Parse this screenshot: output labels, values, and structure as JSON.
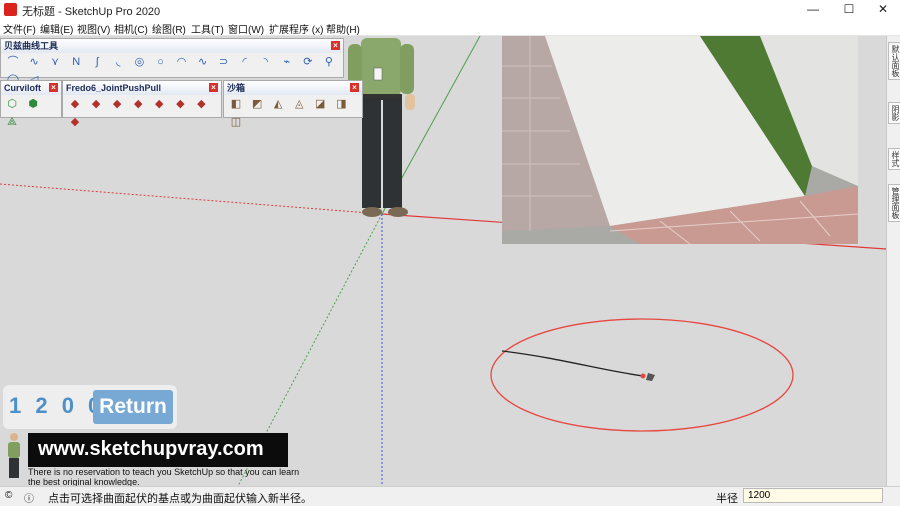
{
  "window": {
    "title": "无标题 - SketchUp Pro 2020",
    "min": "—",
    "max": "☐",
    "close": "✕"
  },
  "menu": [
    "文件(F)",
    "编辑(E)",
    "视图(V)",
    "相机(C)",
    "绘图(R)",
    "工具(T)",
    "窗口(W)",
    "扩展程序 (x)",
    "帮助(H)"
  ],
  "toolbars": {
    "bezier": {
      "title": "贝兹曲线工具",
      "tools": [
        "⌒",
        "∿",
        "⋎",
        "N",
        "∫",
        "◟",
        "◎",
        "○",
        "◠",
        "∿",
        "⊃",
        "◜",
        "◝",
        "⌁",
        "⟳",
        "⚲",
        "◯",
        "◁"
      ]
    },
    "curviloft": {
      "title": "Curviloft",
      "tools": [
        "⬡",
        "⬢",
        "⟁"
      ]
    },
    "fredo": {
      "title": "Fredo6_JointPushPull",
      "tools": [
        "◆",
        "◆",
        "◆",
        "◆",
        "◆",
        "◆",
        "◆",
        "◆"
      ]
    },
    "sandbox": {
      "title": "沙箱",
      "tools": [
        "◧",
        "◩",
        "◭",
        "◬",
        "◪",
        "◨",
        "◫"
      ]
    }
  },
  "rightpanel": {
    "tabs": [
      "默认面板",
      "阴影",
      "样式",
      "管理面板"
    ]
  },
  "status": {
    "message": "点击可选择曲面起伏的基点或为曲面起伏输入新半径。",
    "vcb_label": "半径",
    "vcb_value": "1200"
  },
  "overlay": {
    "number": "1200",
    "number_spaced": "1 2 0 0",
    "return_label": "Return",
    "site": "www.sketchupvray.com",
    "note1": "There is no reservation to teach you SketchUp so that you can learn",
    "note2": "the best original knowledge."
  },
  "colors": {
    "axis_red": "#e0393a",
    "axis_green": "#4da04d",
    "circle": "#e8463f",
    "accent": "#78a9d5"
  }
}
